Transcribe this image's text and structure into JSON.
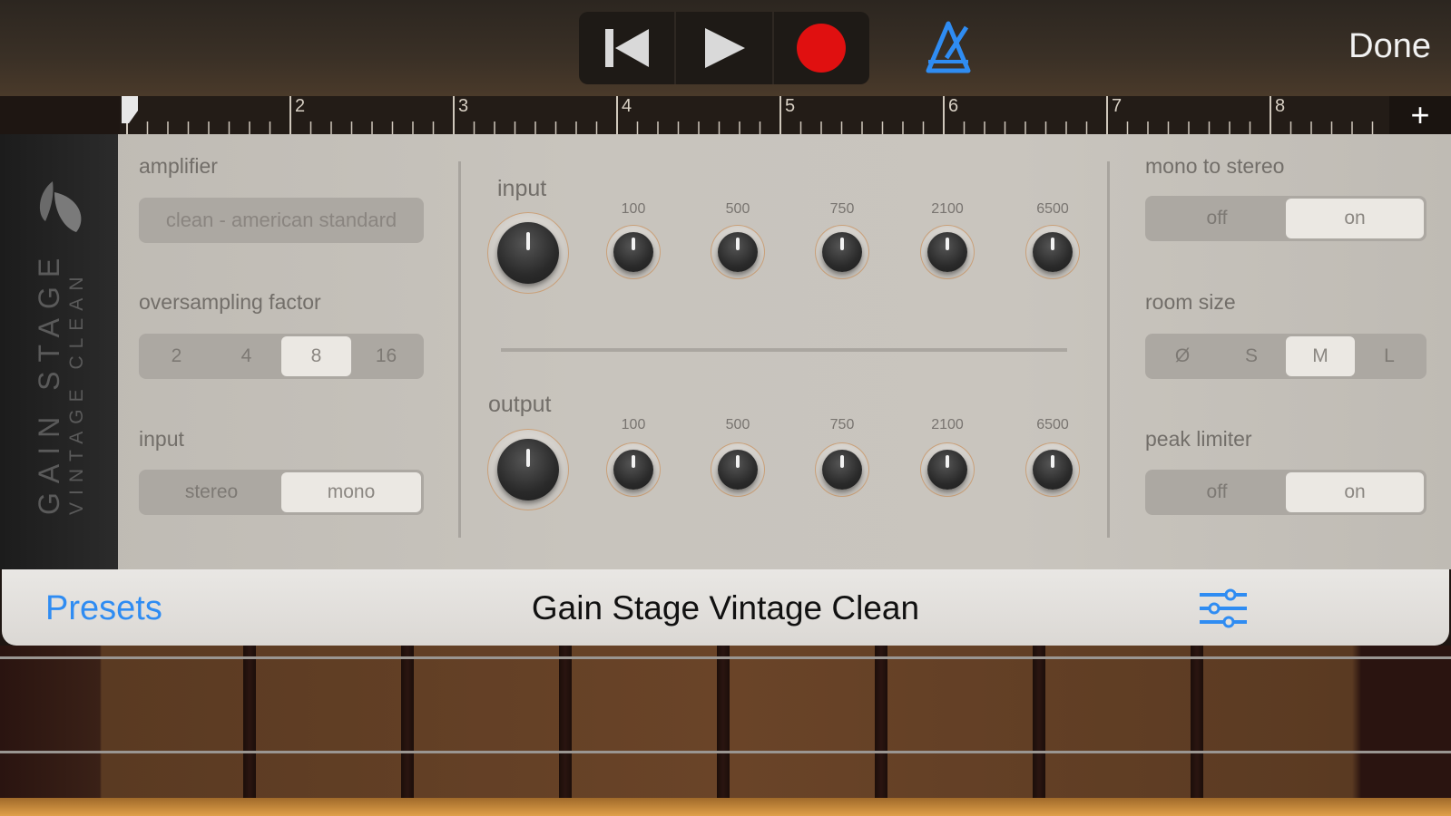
{
  "transport": {
    "rewind_icon": "skip-back-icon",
    "play_icon": "play-icon",
    "record_icon": "record-icon",
    "record_color": "#e01010"
  },
  "metronome": {
    "icon": "metronome-icon",
    "color": "#2f8cf2"
  },
  "done_label": "Done",
  "ruler": {
    "bars": [
      "2",
      "3",
      "4",
      "5",
      "6",
      "7",
      "8"
    ],
    "add_label": "+"
  },
  "plugin": {
    "side_title": "GAIN STAGE",
    "side_subtitle": "VINTAGE CLEAN",
    "amplifier": {
      "label": "amplifier",
      "value": "clean - american standard"
    },
    "oversampling": {
      "label": "oversampling factor",
      "options": [
        "2",
        "4",
        "8",
        "16"
      ],
      "selected": "8"
    },
    "input_mode": {
      "label": "input",
      "options": [
        "stereo",
        "mono"
      ],
      "selected": "mono"
    },
    "eq": {
      "input_label": "input",
      "output_label": "output",
      "bands": [
        "100",
        "500",
        "750",
        "2100",
        "6500"
      ]
    },
    "mono_to_stereo": {
      "label": "mono to stereo",
      "options": [
        "off",
        "on"
      ],
      "selected": "on"
    },
    "room_size": {
      "label": "room size",
      "options": [
        "Ø",
        "S",
        "M",
        "L"
      ],
      "selected": "M"
    },
    "peak_limiter": {
      "label": "peak limiter",
      "options": [
        "off",
        "on"
      ],
      "selected": "on"
    }
  },
  "bottom": {
    "presets_label": "Presets",
    "title": "Gain Stage Vintage Clean",
    "settings_icon": "sliders-icon"
  }
}
